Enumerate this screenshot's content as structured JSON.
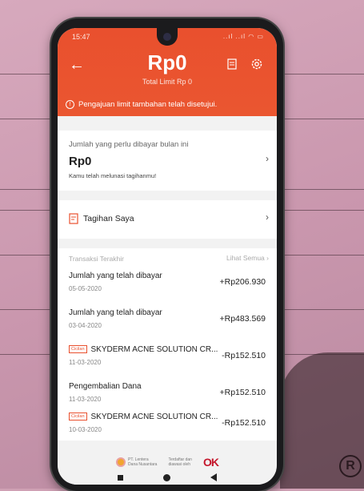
{
  "status": {
    "time": "15:47",
    "icons": "..ıl ..ıl ◠ ▭"
  },
  "header": {
    "balance": "Rp0",
    "limit_label": "Total Limit Rp 0",
    "notice": "Pengajuan limit tambahan telah disetujui."
  },
  "due": {
    "label": "Jumlah yang perlu dibayar bulan ini",
    "amount": "Rp0",
    "note": "Kamu telah melunasi tagihanmu!"
  },
  "bill": {
    "label": "Tagihan Saya"
  },
  "transactions": {
    "heading": "Transaksi Terakhir",
    "see_all": "Lihat Semua",
    "items": [
      {
        "tag": "",
        "name": "Jumlah yang telah dibayar",
        "date": "05-05-2020",
        "amount": "+Rp206.930"
      },
      {
        "tag": "",
        "name": "Jumlah yang telah dibayar",
        "date": "03-04-2020",
        "amount": "+Rp483.569"
      },
      {
        "tag": "Cicilan",
        "name": "SKYDERM ACNE SOLUTION CR...",
        "date": "11-03-2020",
        "amount": "-Rp152.510"
      },
      {
        "tag": "",
        "name": "Pengembalian Dana",
        "date": "11-03-2020",
        "amount": "+Rp152.510"
      },
      {
        "tag": "Cicilan",
        "name": "SKYDERM ACNE SOLUTION CR...",
        "date": "10-03-2020",
        "amount": "-Rp152.510"
      }
    ]
  },
  "footer": {
    "partner_line1": "PT. Lentera",
    "partner_line2": "Dana Nusantara",
    "registered_line1": "Terdaftar dan",
    "registered_line2": "diawasi oleh",
    "ojk": "OK"
  },
  "decor": {
    "registered_mark": "R"
  },
  "colors": {
    "accent": "#e9502e",
    "ojk_red": "#c4162b"
  }
}
